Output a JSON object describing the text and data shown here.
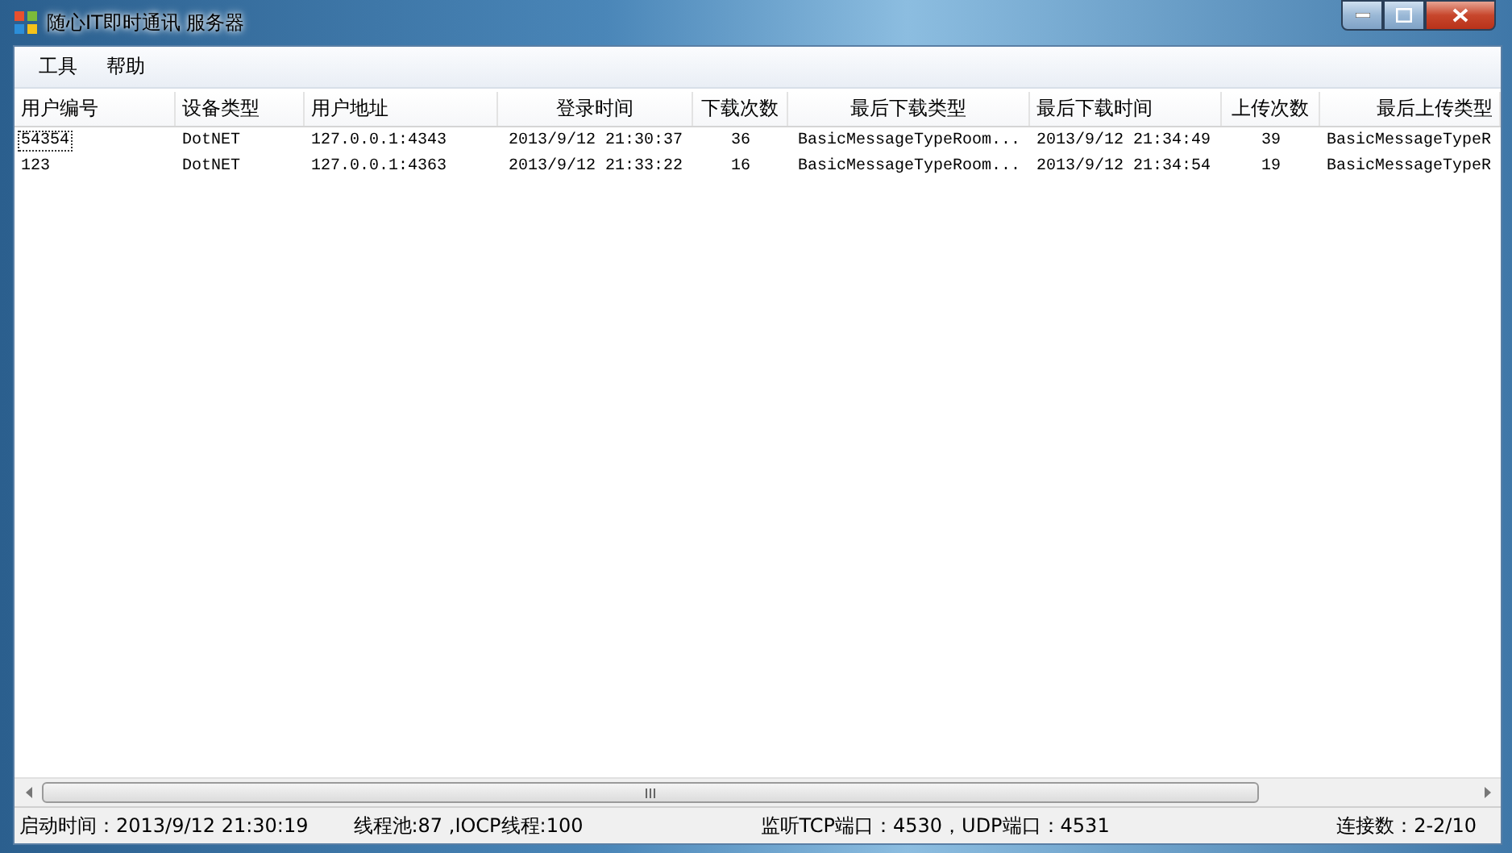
{
  "window": {
    "title": "随心IT即时通讯 服务器"
  },
  "menu": [
    {
      "label": "工具"
    },
    {
      "label": "帮助"
    }
  ],
  "table": {
    "columns": [
      "用户编号",
      "设备类型",
      "用户地址",
      "登录时间",
      "下载次数",
      "最后下载类型",
      "最后下载时间",
      "上传次数",
      "最后上传类型"
    ],
    "rows": [
      {
        "selected": true,
        "cells": [
          "54354",
          "DotNET",
          "127.0.0.1:4343",
          "2013/9/12 21:30:37",
          "36",
          "BasicMessageTypeRoom...",
          "2013/9/12 21:34:49",
          "39",
          "BasicMessageTypeR"
        ]
      },
      {
        "selected": false,
        "cells": [
          "123",
          "DotNET",
          "127.0.0.1:4363",
          "2013/9/12 21:33:22",
          "16",
          "BasicMessageTypeRoom...",
          "2013/9/12 21:34:54",
          "19",
          "BasicMessageTypeR"
        ]
      }
    ]
  },
  "status_bar": [
    "启动时间：2013/9/12 21:30:19",
    "线程池:87 ,IOCP线程:100",
    "监听TCP端口：4530，UDP端口：4531",
    "连接数：2-2/10"
  ]
}
